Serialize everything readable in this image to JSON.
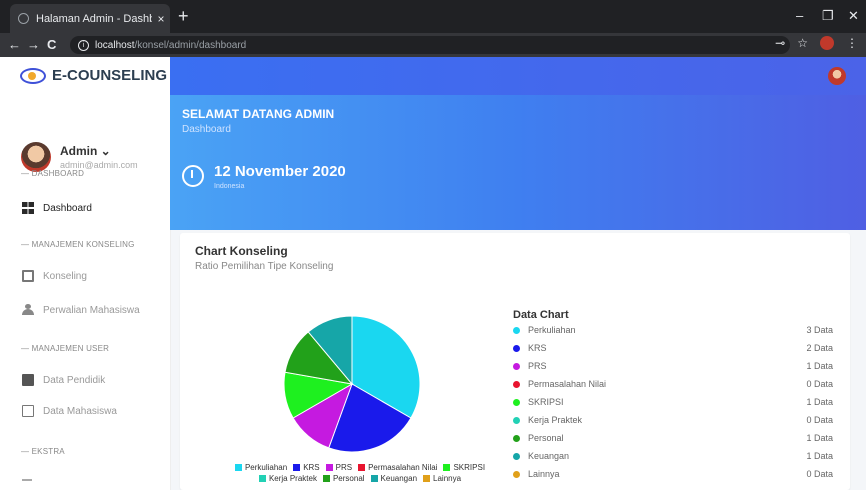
{
  "browser": {
    "tab_title": "Halaman Admin - Dashboard",
    "tab_close": "×",
    "new_tab": "+",
    "url_host": "localhost",
    "url_path": "/konsel/admin/dashboard",
    "window_controls": [
      "–",
      "❐",
      "✕"
    ],
    "nav": [
      "←",
      "→",
      "C"
    ]
  },
  "brand": {
    "name": "E-COUNSELING"
  },
  "user": {
    "name": "Admin ⌄",
    "email": "admin@admin.com"
  },
  "sidebar": {
    "sections": [
      "— DASHBOARD",
      "— MANAJEMEN KONSELING",
      "— MANAJEMEN USER",
      "— EKSTRA"
    ],
    "items": [
      {
        "label": "Dashboard",
        "icon": "dashboard-icon"
      },
      {
        "label": "Konseling",
        "icon": "book-icon"
      },
      {
        "label": "Perwalian Mahasiswa",
        "icon": "people-icon"
      },
      {
        "label": "Data Pendidik",
        "icon": "id-card-icon"
      },
      {
        "label": "Data Mahasiswa",
        "icon": "id-card-outline-icon"
      }
    ]
  },
  "hero": {
    "title": "SELAMAT DATANG ADMIN",
    "subtitle": "Dashboard",
    "date": "12 November 2020",
    "locale": "Indonesia"
  },
  "card": {
    "title": "Chart Konseling",
    "subtitle": "Ratio Pemilihan Tipe Konseling",
    "data_chart_title": "Data Chart"
  },
  "chart_data": {
    "type": "pie",
    "categories": [
      "Perkuliahan",
      "KRS",
      "PRS",
      "Permasalahan Nilai",
      "SKRIPSI",
      "Kerja Praktek",
      "Personal",
      "Keuangan",
      "Lainnya"
    ],
    "values": [
      3,
      2,
      1,
      0,
      1,
      0,
      1,
      1,
      0
    ],
    "colors": [
      "#1ad7f0",
      "#1a1aeb",
      "#c51ae0",
      "#e8142f",
      "#1ef01f",
      "#22d1b5",
      "#22a11a",
      "#16a6a8",
      "#e0a01a"
    ],
    "legend_position": "bottom"
  },
  "data_list": [
    {
      "name": "Perkuliahan",
      "value": "3 Data",
      "color": "#1ad7f0"
    },
    {
      "name": "KRS",
      "value": "2 Data",
      "color": "#1a1aeb"
    },
    {
      "name": "PRS",
      "value": "1 Data",
      "color": "#c51ae0"
    },
    {
      "name": "Permasalahan Nilai",
      "value": "0 Data",
      "color": "#e8142f"
    },
    {
      "name": "SKRIPSI",
      "value": "1 Data",
      "color": "#1ef01f"
    },
    {
      "name": "Kerja Praktek",
      "value": "0 Data",
      "color": "#22d1b5"
    },
    {
      "name": "Personal",
      "value": "1 Data",
      "color": "#22a11a"
    },
    {
      "name": "Keuangan",
      "value": "1 Data",
      "color": "#16a6a8"
    },
    {
      "name": "Lainnya",
      "value": "0 Data",
      "color": "#e0a01a"
    }
  ]
}
